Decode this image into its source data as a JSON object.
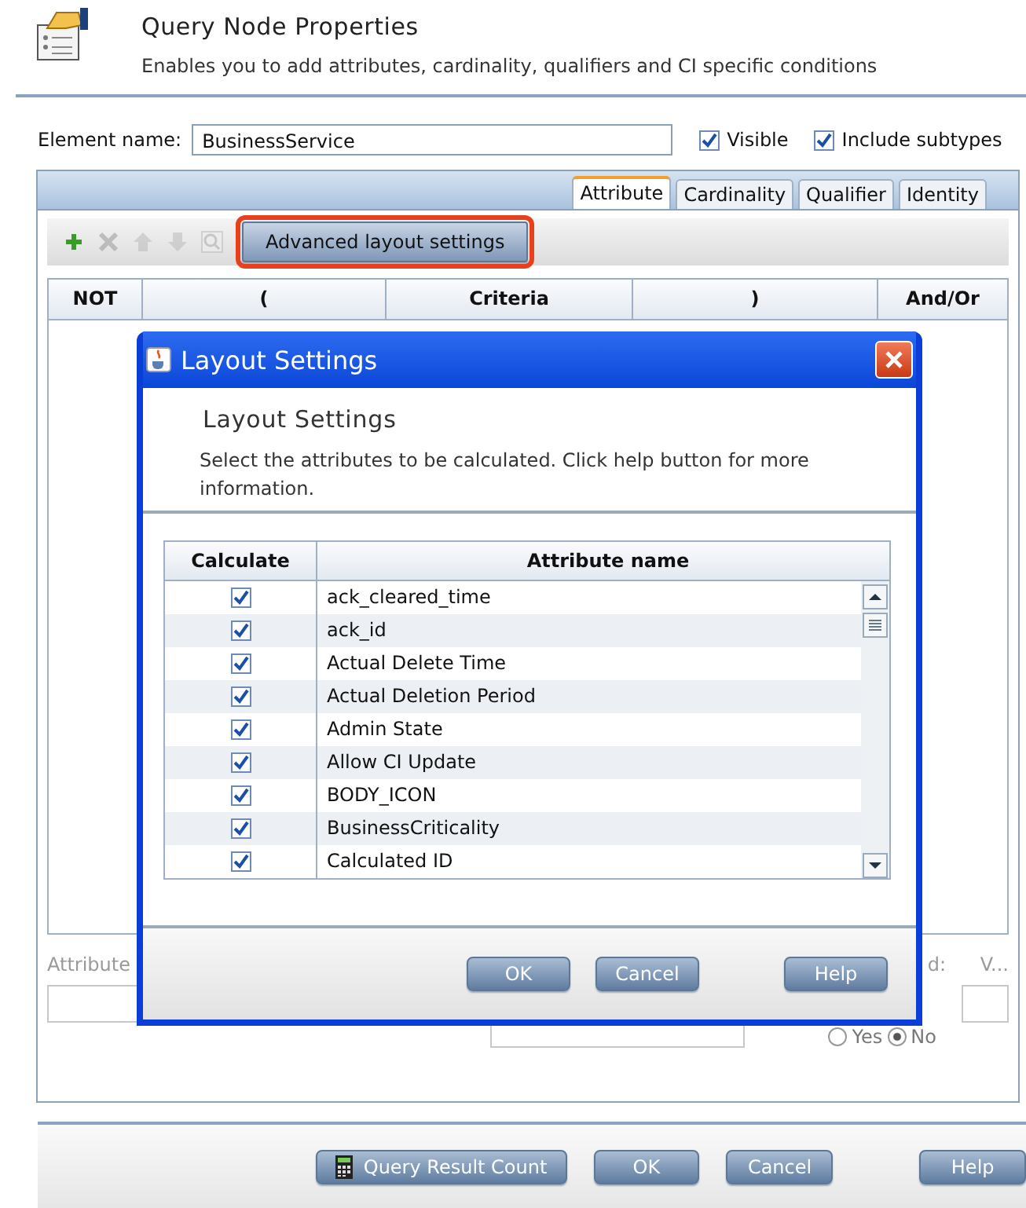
{
  "header": {
    "title": "Query Node Properties",
    "subtitle": "Enables you to add attributes, cardinality, qualifiers and CI specific conditions"
  },
  "element": {
    "label": "Element name:",
    "value": "BusinessService",
    "checks": [
      {
        "label": "Visible",
        "checked": true
      },
      {
        "label": "Include subtypes",
        "checked": true
      }
    ]
  },
  "tabs": [
    {
      "label": "Attribute",
      "selected": true
    },
    {
      "label": "Cardinality",
      "selected": false
    },
    {
      "label": "Qualifier",
      "selected": false
    },
    {
      "label": "Identity",
      "selected": false
    }
  ],
  "tools": [
    {
      "kind": "add",
      "disabled": false
    },
    {
      "kind": "delete",
      "disabled": true
    },
    {
      "kind": "up",
      "disabled": true
    },
    {
      "kind": "down",
      "disabled": true
    },
    {
      "kind": "search",
      "disabled": true
    }
  ],
  "advanced_button": {
    "label": "Advanced layout settings",
    "highlighted": true
  },
  "criteria_columns": [
    "NOT",
    "(",
    "Criteria",
    ")",
    "And/Or"
  ],
  "attribute_area": {
    "label": "Attribute",
    "label_2": "d:",
    "label_3": "V...",
    "radios": [
      {
        "label": "Yes",
        "selected": false
      },
      {
        "label": "No",
        "selected": true
      }
    ]
  },
  "footer_buttons": [
    {
      "label": "Query Result Count",
      "kind": "calculator"
    },
    {
      "label": "OK",
      "kind": "plain"
    },
    {
      "label": "Cancel",
      "kind": "plain"
    },
    {
      "label": "Help",
      "kind": "plain"
    }
  ],
  "dialog": {
    "title": "Layout Settings",
    "heading": "Layout Settings",
    "description": "Select the attributes to be calculated. Click help button for more information.",
    "columns": [
      "Calculate",
      "Attribute name"
    ],
    "rows": [
      {
        "checked": true,
        "name": "ack_cleared_time"
      },
      {
        "checked": true,
        "name": "ack_id"
      },
      {
        "checked": true,
        "name": "Actual Delete Time"
      },
      {
        "checked": true,
        "name": "Actual Deletion Period"
      },
      {
        "checked": true,
        "name": "Admin State"
      },
      {
        "checked": true,
        "name": "Allow CI Update"
      },
      {
        "checked": true,
        "name": "BODY_ICON"
      },
      {
        "checked": true,
        "name": "BusinessCriticality"
      },
      {
        "checked": true,
        "name": "Calculated ID"
      }
    ],
    "buttons": [
      "OK",
      "Cancel",
      "Help"
    ]
  }
}
